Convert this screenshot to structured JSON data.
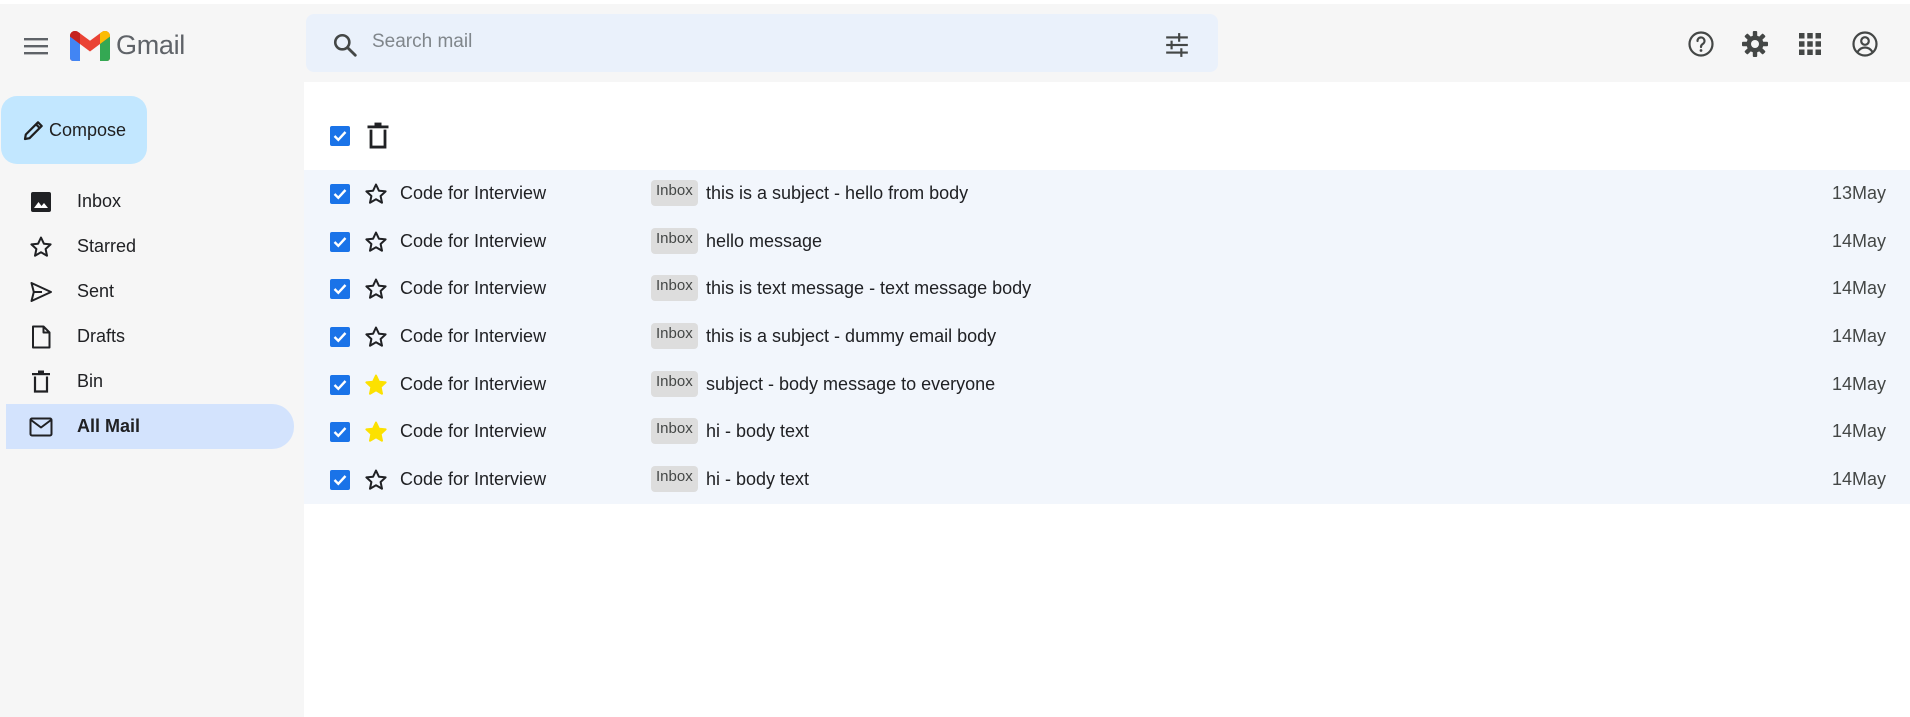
{
  "header": {
    "logo_text": "Gmail",
    "search_placeholder": "Search mail"
  },
  "sidebar": {
    "compose_label": "Compose",
    "items": [
      {
        "label": "Inbox",
        "icon": "image-icon"
      },
      {
        "label": "Starred",
        "icon": "star-icon"
      },
      {
        "label": "Sent",
        "icon": "send-icon"
      },
      {
        "label": "Drafts",
        "icon": "draft-icon"
      },
      {
        "label": "Bin",
        "icon": "trash-icon"
      },
      {
        "label": "All Mail",
        "icon": "mail-icon",
        "active": true
      }
    ]
  },
  "colors": {
    "accent_blue": "#1a73e8",
    "compose_bg": "#c2e7ff",
    "active_nav_bg": "#d3e3fd",
    "selected_row_bg": "#f2f6fc",
    "starred_yellow": "#fce100"
  },
  "emails": [
    {
      "sender": "Code for Interview",
      "label": "Inbox",
      "subject": "this is a subject - hello from body",
      "date": "13May",
      "starred": false,
      "checked": true
    },
    {
      "sender": "Code for Interview",
      "label": "Inbox",
      "subject": "hello message",
      "date": "14May",
      "starred": false,
      "checked": true
    },
    {
      "sender": "Code for Interview",
      "label": "Inbox",
      "subject": "this is text message - text message body",
      "date": "14May",
      "starred": false,
      "checked": true
    },
    {
      "sender": "Code for Interview",
      "label": "Inbox",
      "subject": "this is a subject - dummy email body",
      "date": "14May",
      "starred": false,
      "checked": true
    },
    {
      "sender": "Code for Interview",
      "label": "Inbox",
      "subject": "subject - body message to everyone",
      "date": "14May",
      "starred": true,
      "checked": true
    },
    {
      "sender": "Code for Interview",
      "label": "Inbox",
      "subject": "hi - body text",
      "date": "14May",
      "starred": true,
      "checked": true
    },
    {
      "sender": "Code for Interview",
      "label": "Inbox",
      "subject": "hi - body text",
      "date": "14May",
      "starred": false,
      "checked": true
    }
  ]
}
